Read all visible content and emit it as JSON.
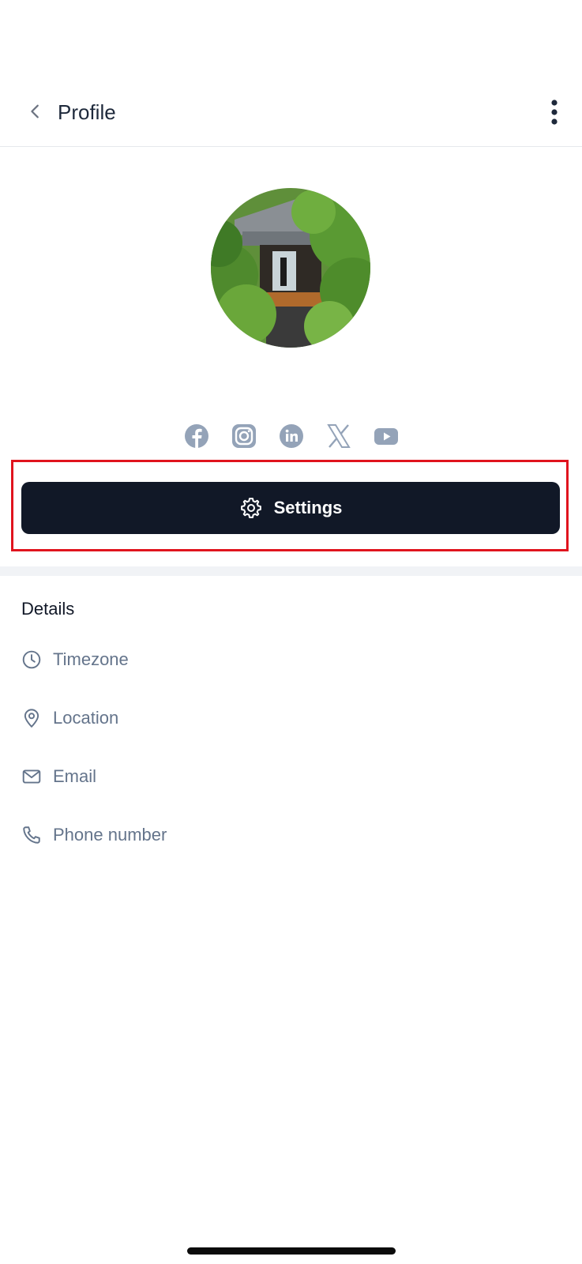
{
  "header": {
    "title": "Profile",
    "back_icon": "chevron-left-icon",
    "more_icon": "more-vertical-icon"
  },
  "avatar": {
    "description_icon": "profile-photo"
  },
  "social": {
    "icons": [
      "facebook-icon",
      "instagram-icon",
      "linkedin-icon",
      "x-icon",
      "youtube-icon"
    ],
    "icon_color": "#94a3b8"
  },
  "settings_button": {
    "label": "Settings",
    "icon": "gear-icon",
    "background": "#111827",
    "highlight_color": "#e0141e"
  },
  "details": {
    "heading": "Details",
    "items": [
      {
        "label": "Timezone",
        "icon": "clock-icon"
      },
      {
        "label": "Location",
        "icon": "map-pin-icon"
      },
      {
        "label": "Email",
        "icon": "mail-icon"
      },
      {
        "label": "Phone number",
        "icon": "phone-icon"
      }
    ]
  }
}
